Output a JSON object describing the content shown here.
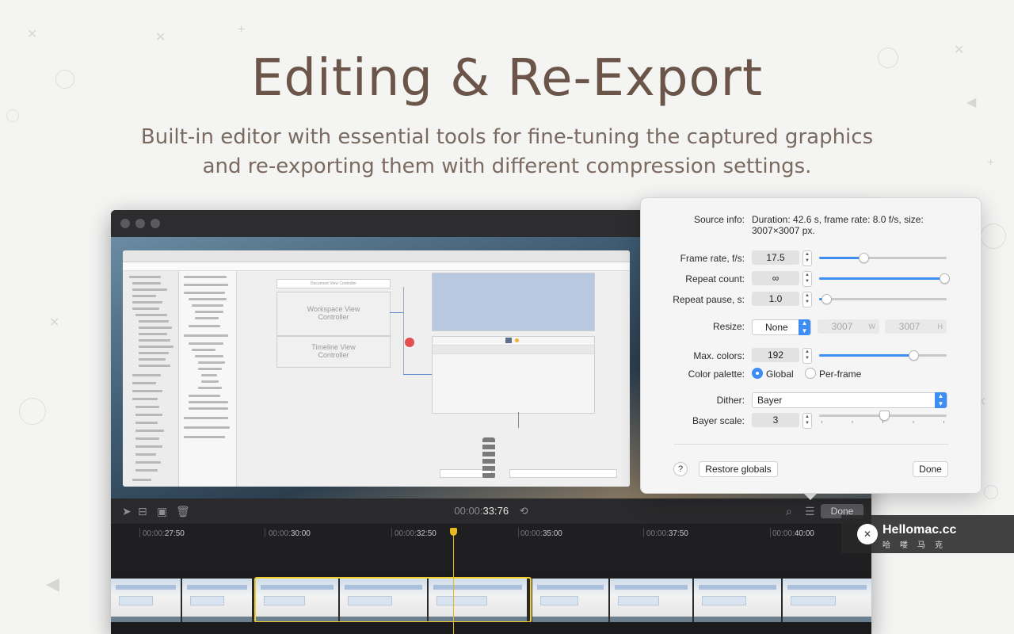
{
  "hero": {
    "title": "Editing & Re-Export",
    "subtitle_line1": "Built-in editor with essential tools for fine-tuning the captured graphics",
    "subtitle_line2": "and re-exporting them with different compression settings."
  },
  "toolbar": {
    "time_prefix": "00:00:",
    "time_value": "33:76",
    "done_label": "Done"
  },
  "timeline": {
    "ticks": [
      {
        "prefix": "00:00:",
        "value": "27:50"
      },
      {
        "prefix": "00:00:",
        "value": "30:00"
      },
      {
        "prefix": "00:00:",
        "value": "32:50"
      },
      {
        "prefix": "00:00:",
        "value": "35:00"
      },
      {
        "prefix": "00:00:",
        "value": "37:50"
      },
      {
        "prefix": "00:00:",
        "value": "40:00"
      }
    ]
  },
  "storyboard": {
    "workspace_label": "Workspace View Controller",
    "timeline_label": "Timeline View Controller",
    "document_label": "Document View Controller"
  },
  "settings": {
    "source_info_label": "Source info:",
    "source_info_value": "Duration: 42.6 s, frame rate: 8.0 f/s, size: 3007×3007 px.",
    "frame_rate_label": "Frame rate, f/s:",
    "frame_rate_value": "17.5",
    "frame_rate_level": 0.34,
    "repeat_count_label": "Repeat count:",
    "repeat_count_value": "∞",
    "repeat_count_level": 1.0,
    "repeat_pause_label": "Repeat pause, s:",
    "repeat_pause_value": "1.0",
    "repeat_pause_level": 0.05,
    "resize_label": "Resize:",
    "resize_value": "None",
    "width_value": "3007",
    "width_unit": "W",
    "height_value": "3007",
    "height_unit": "H",
    "max_colors_label": "Max. colors:",
    "max_colors_value": "192",
    "max_colors_level": 0.73,
    "color_palette_label": "Color palette:",
    "palette_global": "Global",
    "palette_per_frame": "Per-frame",
    "dither_label": "Dither:",
    "dither_value": "Bayer",
    "bayer_scale_label": "Bayer scale:",
    "bayer_scale_value": "3",
    "bayer_scale_level": 0.5,
    "help_label": "?",
    "restore_label": "Restore globals",
    "done_label": "Done"
  },
  "watermark": {
    "brand": "Hellomac.cc",
    "sub": "哈喽马克"
  },
  "colors": {
    "accent": "#3d8df5",
    "playhead": "#e8b820",
    "title": "#6a5548"
  }
}
